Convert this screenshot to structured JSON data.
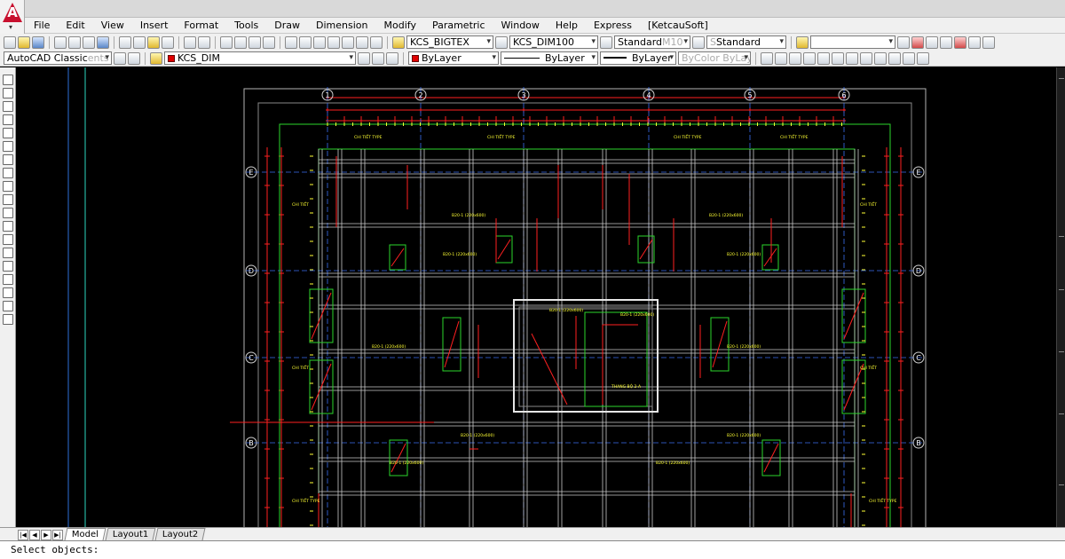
{
  "app": {
    "title": "",
    "logo_icon": "autocad-logo-icon"
  },
  "menu": [
    "File",
    "Edit",
    "View",
    "Insert",
    "Format",
    "Tools",
    "Draw",
    "Dimension",
    "Modify",
    "Parametric",
    "Window",
    "Help",
    "Express",
    "[KetcauSoft]"
  ],
  "toolbar1": {
    "text_style": "KCS_BIGTEX",
    "dim_style": "KCS_DIM100",
    "table_style": "Standard",
    "table_style_ghost": "M10",
    "multileader_style": "Standard",
    "multileader_prefix": "S"
  },
  "toolbar2": {
    "workspace": "AutoCAD Classic",
    "workspace_ghost": "ents",
    "layer": "KCS_DIM",
    "color": "ByLayer",
    "linetype": "ByLayer",
    "lineweight": "ByLayer",
    "plot_style": "ByColor",
    "plot_style_layer": "ByLayer"
  },
  "drawing": {
    "background": "#000000",
    "grid_columns": [
      "1",
      "2",
      "3",
      "4",
      "5",
      "6"
    ],
    "grid_rows": [
      "E",
      "D",
      "C",
      "B"
    ],
    "colors": {
      "beam_outline": "#c8c8c8",
      "dimension": "#ff2020",
      "labels": "#ffff33",
      "grid": "#3a6df0",
      "walls": "#2bd62b",
      "frame": "#b4b4b4"
    },
    "labels": {
      "wall_a": "CHI TIẾT TYPE",
      "beam": "B20-1 (220x600)",
      "wall_b": "CHI TIẾT",
      "core": "THANG BỘ 2-A"
    }
  },
  "tabs": [
    "Model",
    "Layout1",
    "Layout2"
  ],
  "command": {
    "prompt": "Select objects:"
  }
}
